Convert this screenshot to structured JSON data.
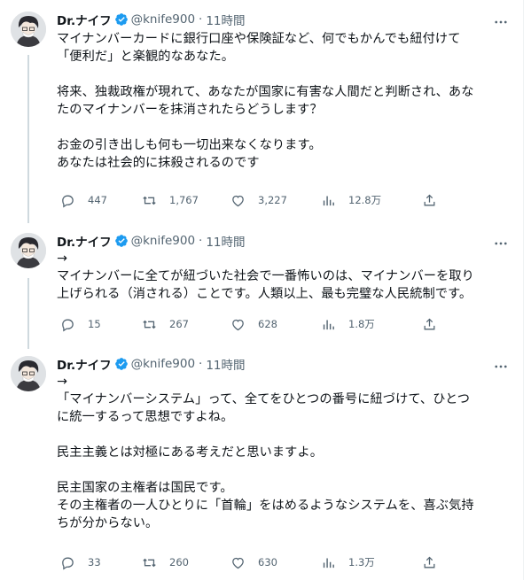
{
  "colors": {
    "text": "#0f1419",
    "secondary": "#536471",
    "verified": "#1d9bf0",
    "thread_line": "#cfd9de"
  },
  "icons": {
    "reply": "reply-icon",
    "retweet": "retweet-icon",
    "like": "heart-icon",
    "views": "views-icon",
    "share": "share-icon",
    "more": "more-icon",
    "verified": "verified-badge-icon"
  },
  "tweets": [
    {
      "name": "Dr.ナイフ",
      "handle": "@knife900",
      "dot": "·",
      "time": "11時間",
      "lines": [
        [
          "マイナンバーカードに銀行口座や保険証など、何でもかんでも紐付けて",
          "「便利だ」と楽観的なあなた。"
        ],
        [
          "将来、独裁政権が現れて、あなたが国家に有害な人間だと判断され、あな",
          "たのマイナンバーを抹消されたらどうします？"
        ],
        [
          "お金の引き出しも何も一切出来なくなります。",
          "あなたは社会的に抹殺されるのです"
        ]
      ],
      "replies": "447",
      "retweets": "1,767",
      "likes": "3,227",
      "views": "12.8万"
    },
    {
      "name": "Dr.ナイフ",
      "handle": "@knife900",
      "dot": "·",
      "time": "11時間",
      "lines": [
        [
          "→",
          "マイナンバーに全てが紐づいた社会で一番怖いのは、マイナンバーを取り",
          "上げられる（消される）ことです。人類以上、最も完璧な人民統制です。"
        ]
      ],
      "replies": "15",
      "retweets": "267",
      "likes": "628",
      "views": "1.8万"
    },
    {
      "name": "Dr.ナイフ",
      "handle": "@knife900",
      "dot": "·",
      "time": "11時間",
      "lines": [
        [
          "→",
          "「マイナンバーシステム」って、全てをひとつの番号に紐づけて、ひとつ",
          "に統一するって思想ですよね。"
        ],
        [
          "民主主義とは対極にある考えだと思いますよ。"
        ],
        [
          "民主国家の主権者は国民です。",
          "その主権者の一人ひとりに「首輪」をはめるようなシステムを、喜ぶ気持",
          "ちが分からない。"
        ]
      ],
      "replies": "33",
      "retweets": "260",
      "likes": "630",
      "views": "1.3万"
    }
  ]
}
